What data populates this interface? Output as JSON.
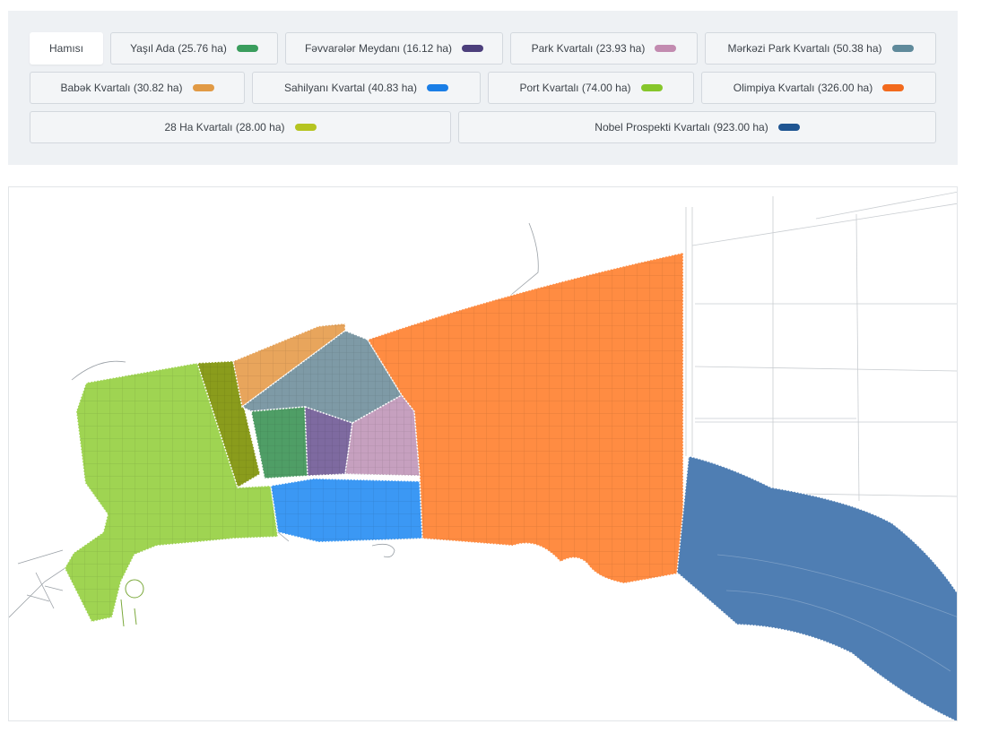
{
  "filters": {
    "all_label": "Hamısı",
    "items": [
      {
        "label": "Yaşıl Ada (25.76 ha)",
        "color": "#3a9d5d"
      },
      {
        "label": "Fəvvarələr Meydanı (16.12 ha)",
        "color": "#4c3f7c"
      },
      {
        "label": "Park Kvartalı (23.93 ha)",
        "color": "#c28bb0"
      },
      {
        "label": "Mərkəzi Park Kvartalı (50.38 ha)",
        "color": "#5f8a9b"
      },
      {
        "label": "Babək Kvartalı (30.82 ha)",
        "color": "#e19a45"
      },
      {
        "label": "Sahilyanı Kvartal (40.83 ha)",
        "color": "#1a7ee6"
      },
      {
        "label": "Port Kvartalı (74.00 ha)",
        "color": "#86c62b"
      },
      {
        "label": "Olimpiya Kvartalı (326.00 ha)",
        "color": "#f26a1d"
      },
      {
        "label": "28 Ha Kvartalı (28.00 ha)",
        "color": "#b5c421"
      },
      {
        "label": "Nobel Prospekti Kvartalı (923.00 ha)",
        "color": "#1f5592"
      }
    ]
  },
  "map": {
    "zone_colors": {
      "port": "#9fd452",
      "ha28": "#8a9c1c",
      "babek": "#e8a55c",
      "merkezi": "#7e9aa6",
      "yasil": "#4f9e66",
      "fevvareler": "#7e6aa0",
      "park": "#c6a0bf",
      "sahilyani": "#3b98f4",
      "olimpiya": "#ff8c42",
      "nobel": "#4f7eb3"
    }
  }
}
